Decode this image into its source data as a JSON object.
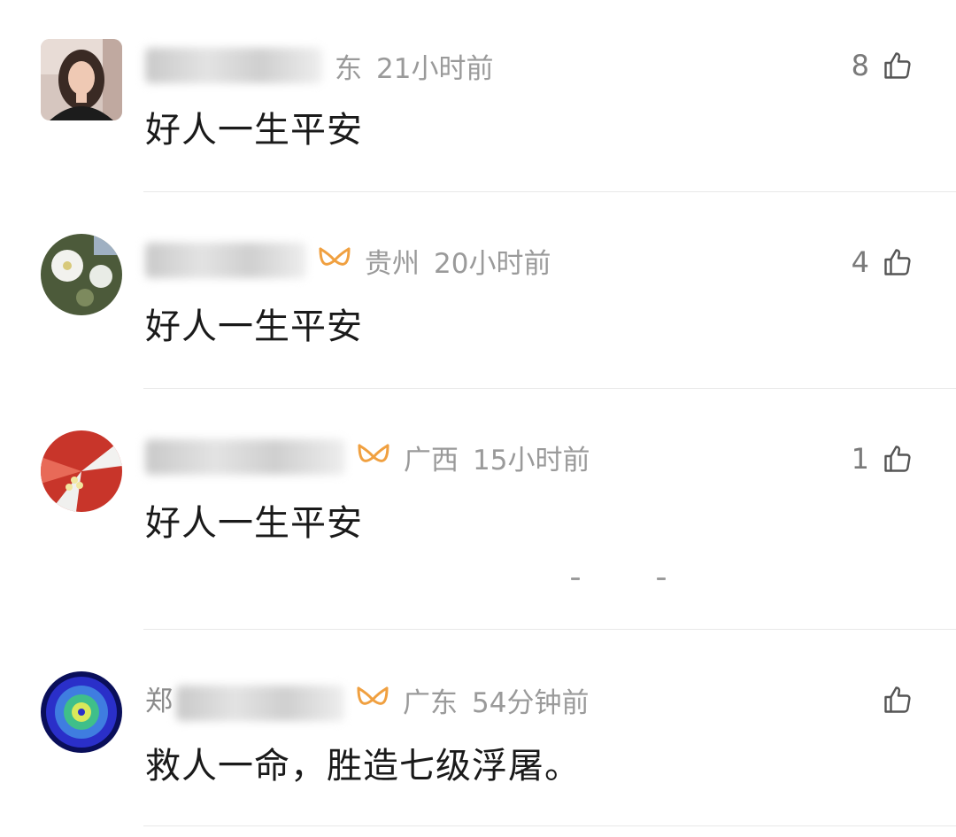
{
  "comments": [
    {
      "name_visible": "",
      "region": "东",
      "time": "21小时前",
      "likes": "8",
      "content": "好人一生平安",
      "vip": false
    },
    {
      "name_visible": "",
      "region": "贵州",
      "time": "20小时前",
      "likes": "4",
      "content": "好人一生平安",
      "vip": true
    },
    {
      "name_visible": "",
      "region": "广西",
      "time": "15小时前",
      "likes": "1",
      "content": "好人一生平安",
      "vip": true
    },
    {
      "name_visible": "郑",
      "region": "广东",
      "time": "54分钟前",
      "likes": "",
      "content": "救人一命，胜造七级浮屠。",
      "vip": true
    }
  ],
  "colors": {
    "vip_orange": "#f0a040",
    "meta_gray": "#9a9a9a",
    "content_black": "#1a1a1a",
    "divider": "#e8e8e8"
  },
  "icons": [
    "thumbs-up-icon",
    "vip-butterfly-icon"
  ]
}
